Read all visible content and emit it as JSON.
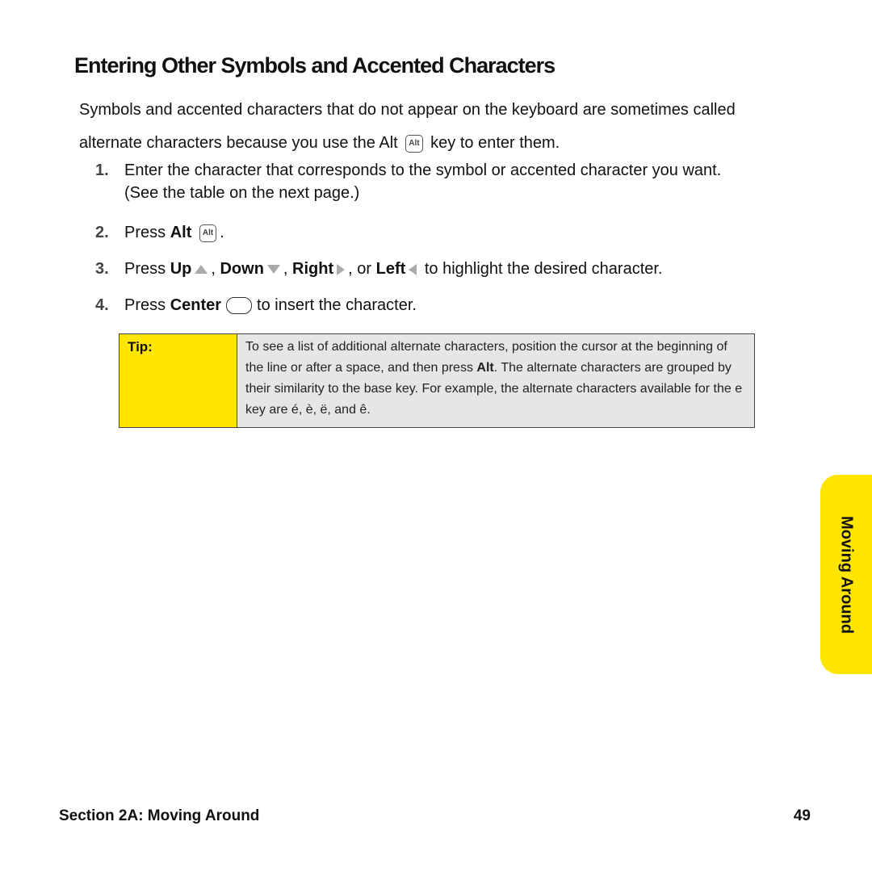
{
  "title": "Entering Other Symbols and Accented Characters",
  "intro": {
    "line1": "Symbols and accented characters that do not appear on the keyboard are sometimes called",
    "line2_before": "alternate characters because you use the Alt",
    "line2_after": "key to enter them."
  },
  "keys": {
    "alt": "Alt"
  },
  "steps": [
    {
      "num": "1.",
      "text": "Enter the character that corresponds to the symbol or accented character you want.",
      "text2": "(See the table on the next page.)"
    },
    {
      "num": "2.",
      "press": "Press",
      "key": "Alt",
      "after": "."
    },
    {
      "num": "3.",
      "press": "Press",
      "up": "Up",
      "down": "Down",
      "right": "Right",
      "or": "or",
      "left": "Left",
      "after": "to highlight the desired character."
    },
    {
      "num": "4.",
      "press": "Press",
      "key": "Center",
      "after": "to insert the character."
    }
  ],
  "tip": {
    "label": "Tip:",
    "before": "To see a list of additional alternate characters, position the cursor at the beginning of the line or after a space, and then press",
    "bold": "Alt",
    "after": ". The alternate characters are grouped by their similarity to the base key. For example, the alternate characters available for the e key are é, è, ë, and ê."
  },
  "side_tab": "Moving Around",
  "footer": {
    "section": "Section 2A: Moving Around",
    "page": "49"
  },
  "colors": {
    "accent": "#ffe500",
    "tip_bg": "#e6e6e6"
  }
}
